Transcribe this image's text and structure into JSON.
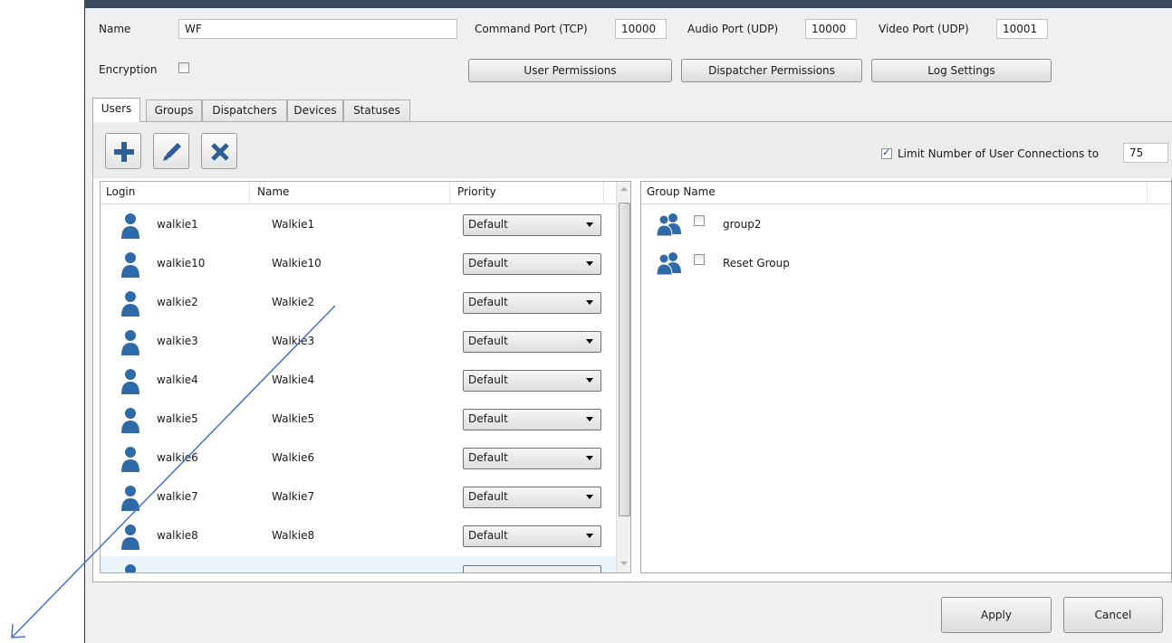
{
  "form": {
    "name_label": "Name",
    "name_value": "WF",
    "command_port_label": "Command Port (TCP)",
    "command_port_value": "10000",
    "audio_port_label": "Audio Port (UDP)",
    "audio_port_value": "10000",
    "video_port_label": "Video Port (UDP)",
    "video_port_value": "10001",
    "encryption_label": "Encryption",
    "encryption_checked": false
  },
  "buttons": {
    "user_permissions": "User Permissions",
    "dispatcher_permissions": "Dispatcher Permissions",
    "log_settings": "Log Settings",
    "apply": "Apply",
    "cancel": "Cancel"
  },
  "tabs": [
    {
      "label": "Users",
      "active": true
    },
    {
      "label": "Groups",
      "active": false
    },
    {
      "label": "Dispatchers",
      "active": false
    },
    {
      "label": "Devices",
      "active": false
    },
    {
      "label": "Statuses",
      "active": false
    }
  ],
  "toolbar": {
    "add_icon": "plus-icon",
    "edit_icon": "pencil-icon",
    "delete_icon": "x-icon",
    "limit_label": "Limit Number of User Connections to",
    "limit_checked": true,
    "limit_value": "75"
  },
  "users_grid": {
    "columns": [
      "Login",
      "Name",
      "Priority"
    ],
    "rows": [
      {
        "login": "walkie1",
        "name": "Walkie1",
        "priority": "Default"
      },
      {
        "login": "walkie10",
        "name": "Walkie10",
        "priority": "Default"
      },
      {
        "login": "walkie2",
        "name": "Walkie2",
        "priority": "Default"
      },
      {
        "login": "walkie3",
        "name": "Walkie3",
        "priority": "Default"
      },
      {
        "login": "walkie4",
        "name": "Walkie4",
        "priority": "Default"
      },
      {
        "login": "walkie5",
        "name": "Walkie5",
        "priority": "Default"
      },
      {
        "login": "walkie6",
        "name": "Walkie6",
        "priority": "Default"
      },
      {
        "login": "walkie7",
        "name": "Walkie7",
        "priority": "Default"
      },
      {
        "login": "walkie8",
        "name": "Walkie8",
        "priority": "Default"
      }
    ]
  },
  "groups_grid": {
    "column": "Group Name",
    "rows": [
      {
        "name": "group2",
        "checked": false
      },
      {
        "name": "Reset Group",
        "checked": false
      }
    ]
  },
  "colors": {
    "user_icon": "#2f6aa8",
    "annotation_arrow": "#4472c4"
  }
}
